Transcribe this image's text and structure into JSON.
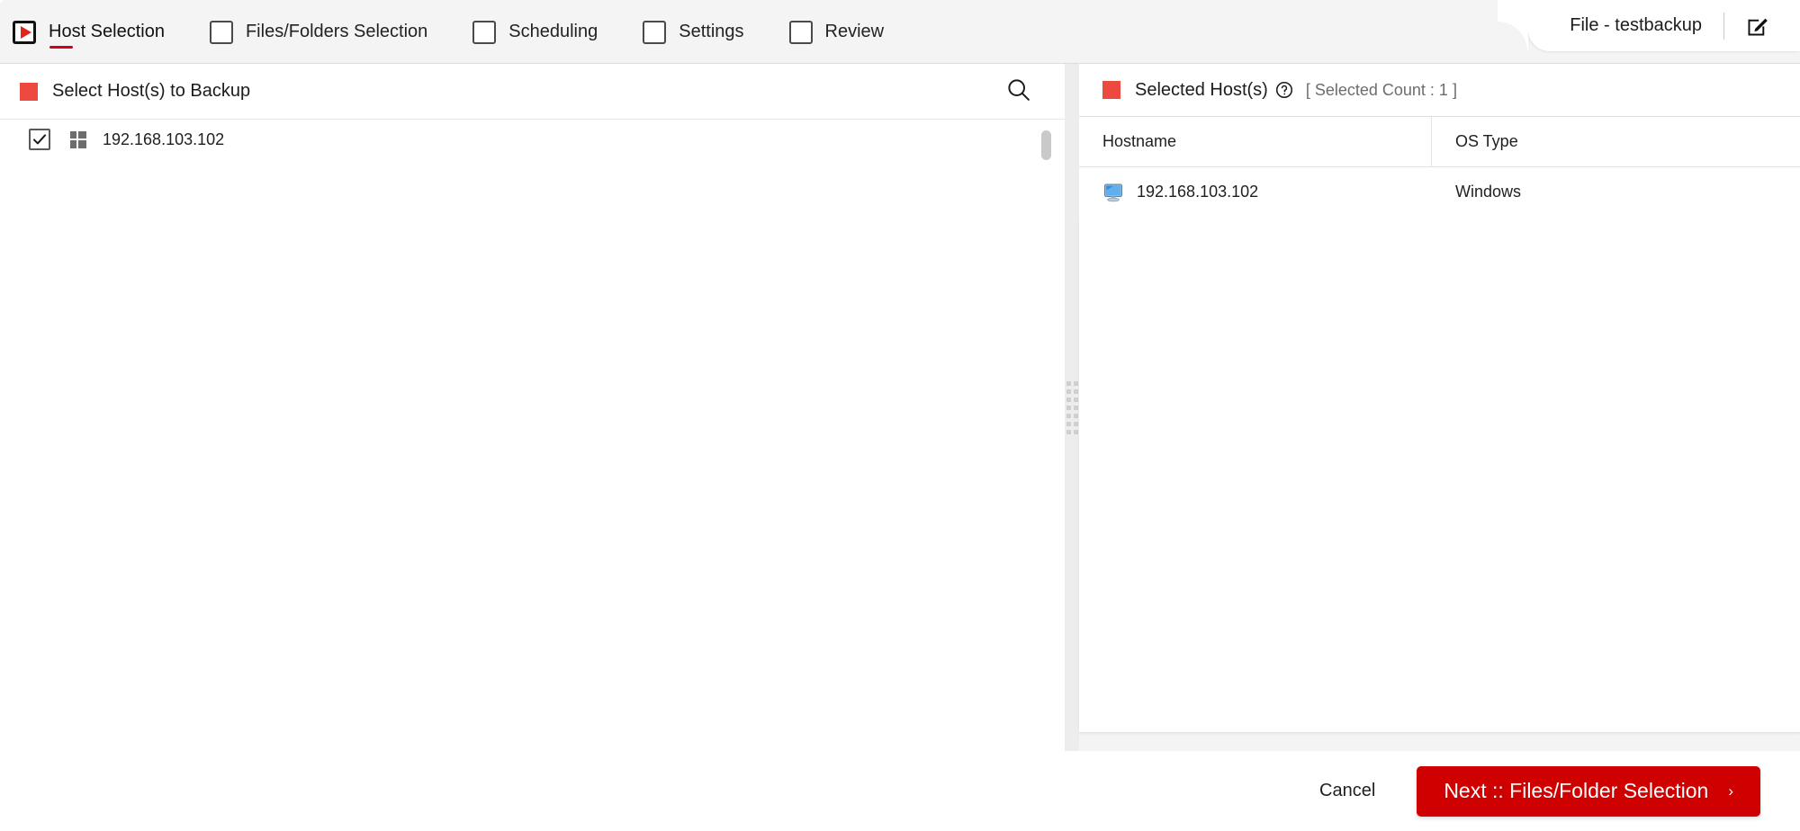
{
  "window": {
    "job_title": "File - testbackup",
    "edit_icon": "edit-pencil-icon"
  },
  "stepper": {
    "steps": [
      {
        "label": "Host Selection",
        "active": true,
        "icon": "play-square-icon"
      },
      {
        "label": "Files/Folders Selection",
        "active": false,
        "icon": "empty-square-icon"
      },
      {
        "label": "Scheduling",
        "active": false,
        "icon": "empty-square-icon"
      },
      {
        "label": "Settings",
        "active": false,
        "icon": "empty-square-icon"
      },
      {
        "label": "Review",
        "active": false,
        "icon": "empty-square-icon"
      }
    ]
  },
  "left_panel": {
    "title": "Select Host(s) to Backup",
    "marker_color": "#ec4a3e",
    "search_icon": "search-icon",
    "tree": [
      {
        "label": "192.168.103.102",
        "checked": true,
        "os_icon": "windows-logo-icon"
      }
    ]
  },
  "right_panel": {
    "title": "Selected Host(s)",
    "help_icon": "help-circle-icon",
    "count_label": "[ Selected Count : 1 ]",
    "marker_color": "#ec4a3e",
    "table": {
      "columns": [
        "Hostname",
        "OS Type"
      ],
      "rows": [
        {
          "hostname": "192.168.103.102",
          "os_type": "Windows",
          "icon": "computer-monitor-icon"
        }
      ]
    }
  },
  "footer": {
    "cancel_label": "Cancel",
    "next_label": "Next :: Files/Folder Selection",
    "next_caret": "›",
    "next_color": "#ce0000"
  }
}
